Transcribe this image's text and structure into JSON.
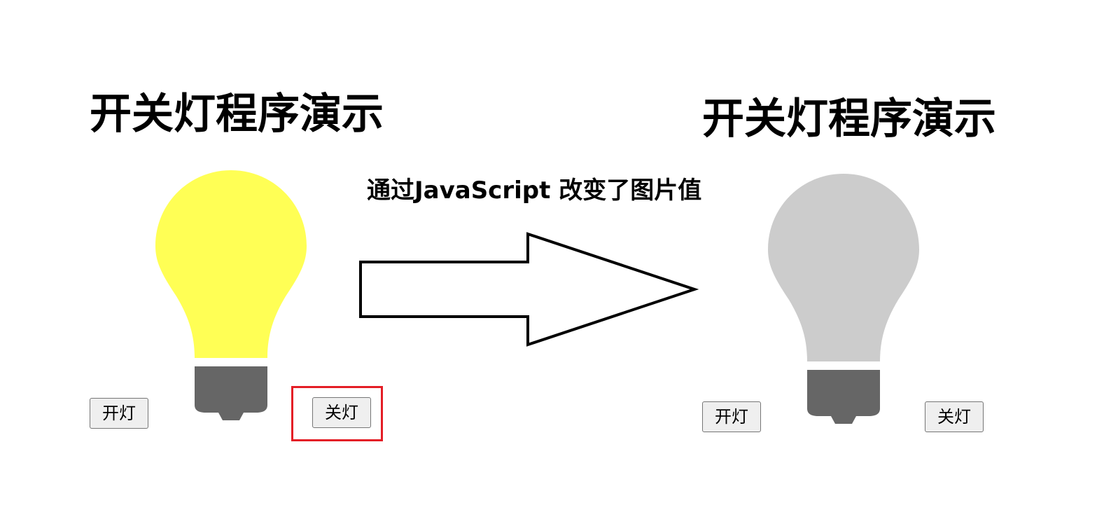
{
  "left_panel": {
    "title": "开关灯程序演示",
    "bulb_state": "on",
    "bulb_color": "#ffff55",
    "base_color": "#666666",
    "on_button_label": "开灯",
    "off_button_label": "关灯",
    "highlight_color": "#e41e26"
  },
  "caption": "通过JavaScript 改变了图片值",
  "arrow_icon": "right-arrow-icon",
  "right_panel": {
    "title": "开关灯程序演示",
    "bulb_state": "off",
    "bulb_color": "#cccccc",
    "base_color": "#666666",
    "on_button_label": "开灯",
    "off_button_label": "关灯"
  }
}
